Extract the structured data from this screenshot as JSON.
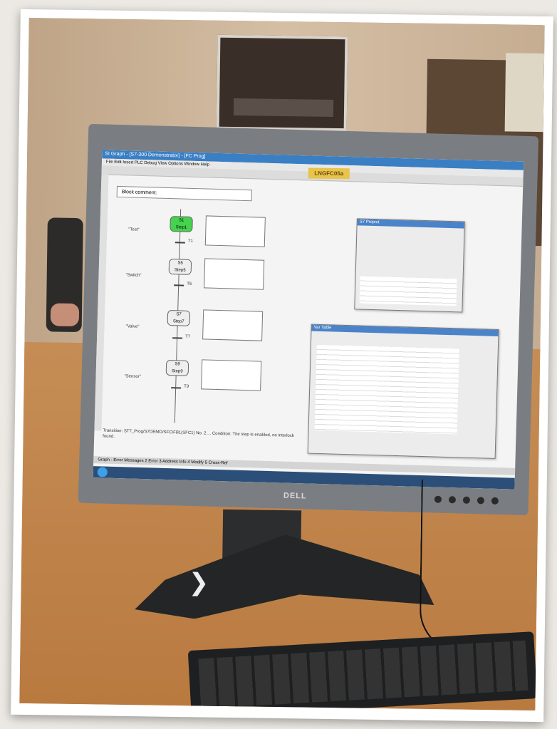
{
  "screen": {
    "title_bar": "SI Graph - [S7-300 Demonstrator] - [FC Prog]",
    "menu": "File  Edit  Insert  PLC  Debug  View  Options  Window  Help",
    "comment_label": "Block comment:",
    "status_message": "Transition: ST7_Prog/S7DEMO/SFC\\FB1(SFC1)   No. 2 ... Condition: The step is enabled, no interlock found.",
    "status_bar": "Graph - Error Messages   2 Error   3 Address Info   4 Modify   5 Cross-Ref",
    "steps": [
      {
        "id": "S1",
        "name": "Step1",
        "active": true
      },
      {
        "id": "S5",
        "name": "Step5",
        "active": false
      },
      {
        "id": "S7",
        "name": "Step7",
        "active": false
      },
      {
        "id": "S9",
        "name": "Step9",
        "active": false
      }
    ],
    "transitions": [
      "T1",
      "T5",
      "T7",
      "T9"
    ],
    "transition_labels": [
      "\"Test\"",
      "\"Switch\"",
      "\"Valve\"",
      "\"Sensor\""
    ],
    "panel_small_title": "S7 Project",
    "panel_large_title": "Var Table"
  },
  "sticker": "LNGFC05a",
  "brand": "DELL",
  "colors": {
    "active_step": "#45d24e",
    "titlebar": "#3a7fc4",
    "sticker": "#e8c44a"
  }
}
